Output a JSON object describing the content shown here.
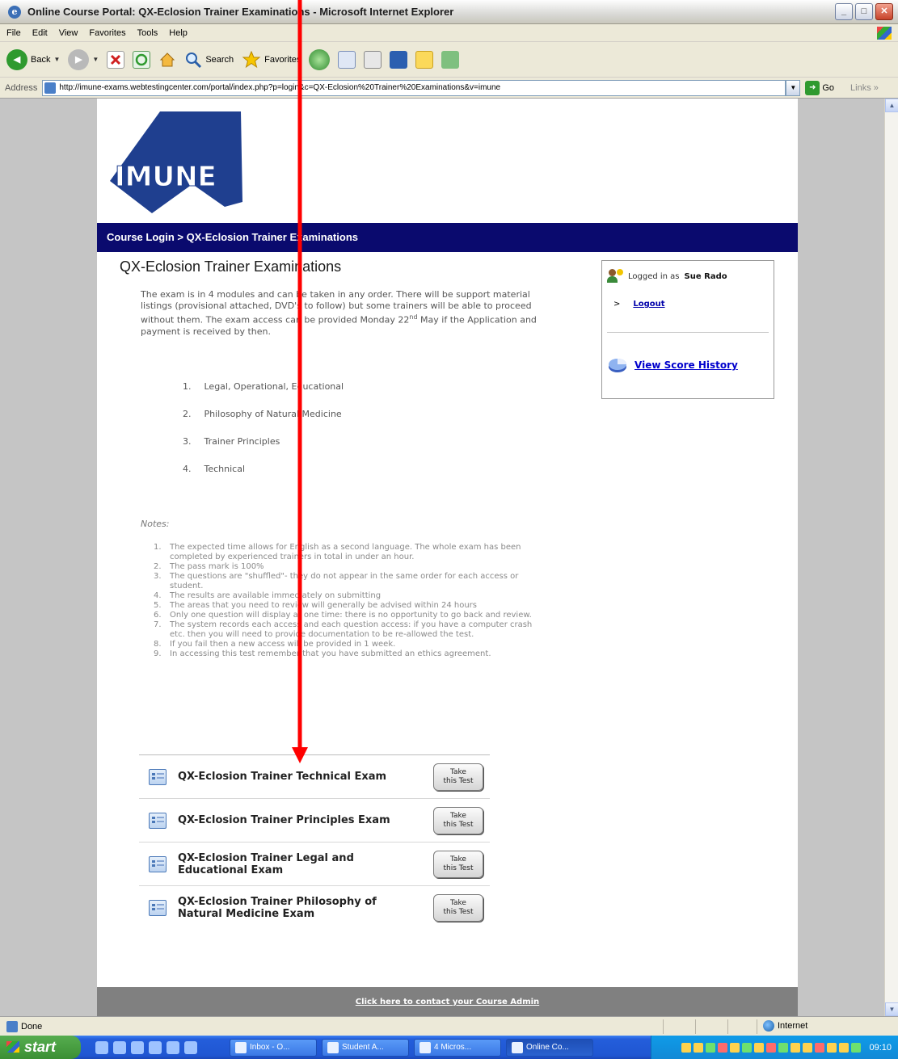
{
  "window": {
    "title": "Online Course Portal: QX-Eclosion Trainer Examinations - Microsoft Internet Explorer",
    "controls": [
      "_",
      "□",
      "✕"
    ]
  },
  "menubar": {
    "items": [
      "File",
      "Edit",
      "View",
      "Favorites",
      "Tools",
      "Help"
    ]
  },
  "toolbar": {
    "back_label": "Back",
    "search_label": "Search",
    "favorites_label": "Favorites"
  },
  "addressbar": {
    "label": "Address",
    "url": "http://imune-exams.webtestingcenter.com/portal/index.php?p=login&c=QX-Eclosion%20Trainer%20Examinations&v=imune",
    "go_label": "Go",
    "links_label": "Links »"
  },
  "page": {
    "logo_text": "IMUNE",
    "breadcrumb": "Course Login > QX-Eclosion Trainer Examinations",
    "heading": "QX-Eclosion Trainer Examinations",
    "intro_before_sup": "The exam is in 4 modules and can be taken in any order. There will be support material listings (provisional attached, DVD's to follow) but some trainers will be able to proceed without them. The exam access can be provided Monday 22",
    "intro_sup": "nd",
    "intro_after_sup": " May if the Application and payment is received by then.",
    "modules": [
      {
        "num": "1.",
        "label": "Legal, Operational, Educational"
      },
      {
        "num": "2.",
        "label": "Philosophy of Natural Medicine"
      },
      {
        "num": "3.",
        "label": "Trainer Principles"
      },
      {
        "num": "4.",
        "label": "Technical"
      }
    ],
    "notes_title": "Notes:",
    "notes": [
      {
        "num": "1.",
        "text": "The expected time allows for English as a second language. The whole exam has been completed by experienced trainers in total in under an hour."
      },
      {
        "num": "2.",
        "text": "The pass mark is 100%"
      },
      {
        "num": "3.",
        "text": "The questions are \"shuffled\"- they do not appear in the same order for each access or student."
      },
      {
        "num": "4.",
        "text": "The results are available immediately on submitting"
      },
      {
        "num": "5.",
        "text": "The areas that you need to review will generally be advised within 24 hours"
      },
      {
        "num": "6.",
        "text": "Only one question will display at one time: there is no opportunity to go back and review."
      },
      {
        "num": "7.",
        "text": "The system records each access and each question access: if you have a computer crash etc. then you will need to provide documentation to be re-allowed the test."
      },
      {
        "num": "8.",
        "text": "If you fail then a new access will be provided in 1 week."
      },
      {
        "num": "9.",
        "text": "In accessing this test remember that you have submitted an ethics agreement."
      }
    ],
    "tests": [
      {
        "name": "QX-Eclosion Trainer Technical Exam",
        "button_line1": "Take",
        "button_line2": "this Test"
      },
      {
        "name": "QX-Eclosion Trainer Principles Exam",
        "button_line1": "Take",
        "button_line2": "this Test"
      },
      {
        "name": "QX-Eclosion Trainer Legal and Educational Exam",
        "button_line1": "Take",
        "button_line2": "this Test"
      },
      {
        "name": "QX-Eclosion Trainer Philosophy of Natural Medicine Exam",
        "button_line1": "Take",
        "button_line2": "this Test"
      }
    ],
    "sidebar": {
      "logged_in_prefix": "Logged in as",
      "user_name": "Sue Rado",
      "logout_bullet": ">",
      "logout_label": "Logout",
      "score_history_label": "View Score History"
    },
    "footer_link": "Click here to contact your Course Admin"
  },
  "statusbar": {
    "status": "Done",
    "zone": "Internet"
  },
  "taskbar": {
    "start_label": "start",
    "tasks": [
      {
        "label": "Inbox - O..."
      },
      {
        "label": "Student A..."
      },
      {
        "label": "4 Micros..."
      },
      {
        "label": "Online Co..."
      }
    ],
    "clock": "09:10"
  },
  "colors": {
    "nav_bar": "#0a0a6e",
    "footer": "#808080",
    "annotation_arrow": "#ff0000",
    "logo": "#1f3f8f"
  }
}
